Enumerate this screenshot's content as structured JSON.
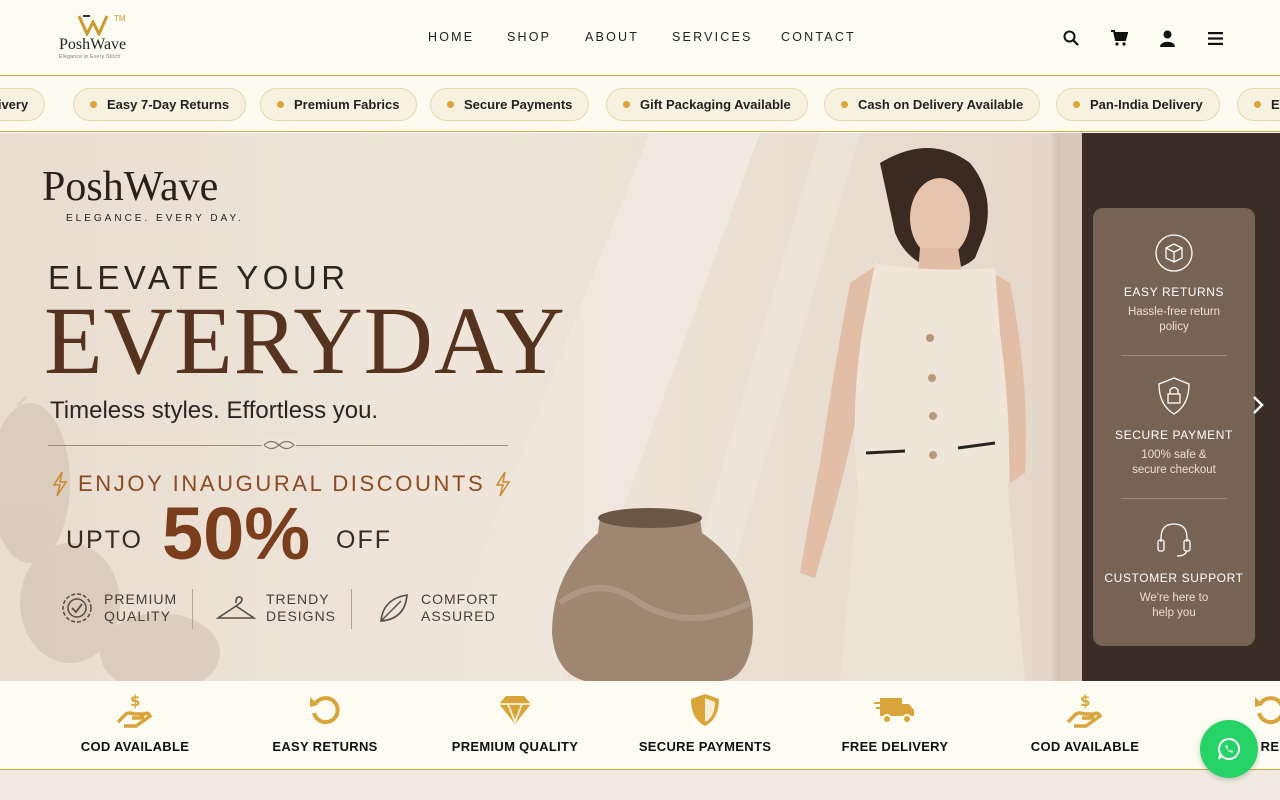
{
  "header": {
    "logo_name": "PoshWave",
    "logo_tm": "TM",
    "logo_tagline": "Elegance in Every Stitch",
    "nav": [
      "HOME",
      "SHOP",
      "ABOUT",
      "SERVICES",
      "CONTACT"
    ],
    "icons": [
      "search-icon",
      "cart-icon",
      "user-icon",
      "menu-icon"
    ]
  },
  "ticker": {
    "items": [
      "elivery",
      "Easy 7-Day Returns",
      "Premium Fabrics",
      "Secure Payments",
      "Gift Packaging Available",
      "Cash on Delivery Available",
      "Pan-India Delivery",
      "Ea"
    ]
  },
  "hero": {
    "brand_name": "PoshWave",
    "brand_tagline": "ELEGANCE. EVERY DAY.",
    "line1": "ELEVATE YOUR",
    "line2": "EVERYDAY",
    "line3": "Timeless styles. Effortless you.",
    "discount": "ENJOY INAUGURAL DISCOUNTS",
    "upto": "UPTO",
    "percent": "50%",
    "off": "OFF",
    "features": [
      {
        "icon": "badge-check-icon",
        "label": "PREMIUM\nQUALITY"
      },
      {
        "icon": "hanger-icon",
        "label": "TRENDY\nDESIGNS"
      },
      {
        "icon": "leaf-icon",
        "label": "COMFORT\nASSURED"
      }
    ],
    "side_panel": [
      {
        "icon": "box-return-icon",
        "title": "EASY RETURNS",
        "desc": "Hassle-free return\npolicy"
      },
      {
        "icon": "shield-lock-icon",
        "title": "SECURE PAYMENT",
        "desc": "100% safe &\nsecure checkout"
      },
      {
        "icon": "headset-icon",
        "title": "CUSTOMER SUPPORT",
        "desc": "We're here to\nhelp you"
      }
    ]
  },
  "benefits": [
    {
      "icon": "hand-dollar-icon",
      "label": "COD AVAILABLE"
    },
    {
      "icon": "undo-icon",
      "label": "EASY RETURNS"
    },
    {
      "icon": "diamond-icon",
      "label": "PREMIUM QUALITY"
    },
    {
      "icon": "shield-icon",
      "label": "SECURE PAYMENTS"
    },
    {
      "icon": "truck-icon",
      "label": "FREE DELIVERY"
    },
    {
      "icon": "hand-dollar-icon",
      "label": "COD AVAILABLE"
    },
    {
      "icon": "undo-icon",
      "label": "RE"
    }
  ],
  "colors": {
    "gold": "#d9a43a",
    "brown": "#55331f",
    "whatsapp": "#25d366"
  }
}
